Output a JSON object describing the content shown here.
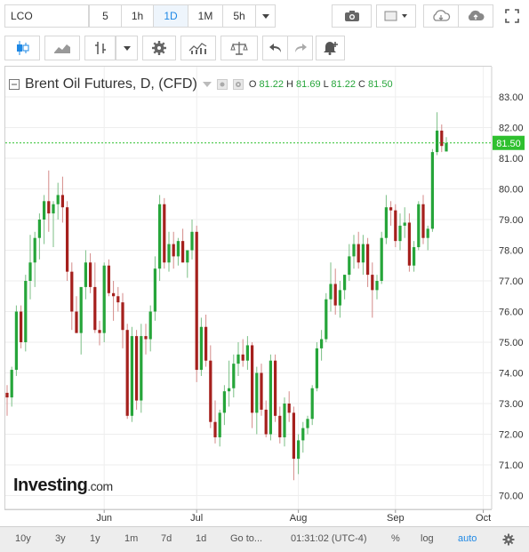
{
  "toolbar": {
    "symbol": "LCO",
    "intervals": [
      "5",
      "1h",
      "1D",
      "1M",
      "5h"
    ],
    "active_interval": "1D"
  },
  "legend": {
    "title": "Brent Oil Futures, D, (CFD)",
    "o_label": "O",
    "o": "81.22",
    "h_label": "H",
    "h": "81.69",
    "l_label": "L",
    "l": "81.22",
    "c_label": "C",
    "c": "81.50"
  },
  "price_badge": "81.50",
  "logo": {
    "main": "Investing",
    "suffix": ".com"
  },
  "bottom_bar": {
    "ranges": [
      "10y",
      "3y",
      "1y",
      "1m",
      "7d",
      "1d",
      "Go to..."
    ],
    "time": "01:31:02 (UTC-4)",
    "percent": "%",
    "log": "log",
    "auto": "auto"
  },
  "colors": {
    "up": "#26a53a",
    "down": "#a5201d",
    "grid": "#eeeeee",
    "active": "#1e88e5",
    "last_price": "#2fc02f"
  },
  "chart_data": {
    "type": "candlestick",
    "title": "Brent Oil Futures, D, (CFD)",
    "x_ticks": [
      "Jun",
      "Jul",
      "Aug",
      "Sep",
      "Oct"
    ],
    "y_ticks": [
      70.0,
      71.0,
      72.0,
      73.0,
      74.0,
      75.0,
      76.0,
      77.0,
      78.0,
      79.0,
      80.0,
      81.0,
      82.0,
      83.0
    ],
    "ylim": [
      69.5,
      83.5
    ],
    "last_price": 81.5,
    "grid": true,
    "candles": [
      [
        73.35,
        73.6,
        72.6,
        73.2
      ],
      [
        73.2,
        74.2,
        72.9,
        74.1
      ],
      [
        74.1,
        76.2,
        73.9,
        76.0
      ],
      [
        76.0,
        76.2,
        74.8,
        75.0
      ],
      [
        75.0,
        77.2,
        74.7,
        77.0
      ],
      [
        77.0,
        78.5,
        76.4,
        77.6
      ],
      [
        77.6,
        78.6,
        76.8,
        78.4
      ],
      [
        78.4,
        79.2,
        77.7,
        79.0
      ],
      [
        79.0,
        79.8,
        78.2,
        79.6
      ],
      [
        79.6,
        80.6,
        78.6,
        79.2
      ],
      [
        79.2,
        79.6,
        78.1,
        79.5
      ],
      [
        79.5,
        80.2,
        79.0,
        79.8
      ],
      [
        79.8,
        80.4,
        78.9,
        79.4
      ],
      [
        79.4,
        79.6,
        77.0,
        77.3
      ],
      [
        77.3,
        77.6,
        75.4,
        76.0
      ],
      [
        76.0,
        76.5,
        75.3,
        75.3
      ],
      [
        75.3,
        76.6,
        74.6,
        76.8
      ],
      [
        76.8,
        78.0,
        76.4,
        77.6
      ],
      [
        77.6,
        77.9,
        76.6,
        76.8
      ],
      [
        76.8,
        77.6,
        75.3,
        75.4
      ],
      [
        75.4,
        75.7,
        74.9,
        75.3
      ],
      [
        75.3,
        77.6,
        75.0,
        77.5
      ],
      [
        77.5,
        77.7,
        76.5,
        76.6
      ],
      [
        76.6,
        77.0,
        75.7,
        76.5
      ],
      [
        76.5,
        76.8,
        76.0,
        76.3
      ],
      [
        76.3,
        76.6,
        74.8,
        75.4
      ],
      [
        75.4,
        75.6,
        72.5,
        72.6
      ],
      [
        72.6,
        75.5,
        72.4,
        75.2
      ],
      [
        75.2,
        75.4,
        72.8,
        73.1
      ],
      [
        73.1,
        75.6,
        72.7,
        75.2
      ],
      [
        75.2,
        75.6,
        74.6,
        75.1
      ],
      [
        75.1,
        76.2,
        74.7,
        76.0
      ],
      [
        76.0,
        77.8,
        75.7,
        77.4
      ],
      [
        77.4,
        79.8,
        77.0,
        79.5
      ],
      [
        79.5,
        79.7,
        77.4,
        77.6
      ],
      [
        77.6,
        78.6,
        77.3,
        78.2
      ],
      [
        78.2,
        78.6,
        77.4,
        77.8
      ],
      [
        77.8,
        78.4,
        77.5,
        78.3
      ],
      [
        78.3,
        78.7,
        77.6,
        77.6
      ],
      [
        77.6,
        78.0,
        77.1,
        78.0
      ],
      [
        78.0,
        79.0,
        77.7,
        78.6
      ],
      [
        78.6,
        78.8,
        73.7,
        74.1
      ],
      [
        74.1,
        75.8,
        73.9,
        75.5
      ],
      [
        75.5,
        75.9,
        74.2,
        74.4
      ],
      [
        74.4,
        74.9,
        72.2,
        72.4
      ],
      [
        72.4,
        73.1,
        71.7,
        71.9
      ],
      [
        71.9,
        72.8,
        71.6,
        72.7
      ],
      [
        72.7,
        73.6,
        72.3,
        73.4
      ],
      [
        73.4,
        74.4,
        72.9,
        73.5
      ],
      [
        73.5,
        74.6,
        73.2,
        74.3
      ],
      [
        74.3,
        75.0,
        73.9,
        74.6
      ],
      [
        74.6,
        75.1,
        74.2,
        74.4
      ],
      [
        74.4,
        75.2,
        74.1,
        74.9
      ],
      [
        74.9,
        75.0,
        72.2,
        72.7
      ],
      [
        72.7,
        74.2,
        72.0,
        74.0
      ],
      [
        74.0,
        74.3,
        72.6,
        72.8
      ],
      [
        72.8,
        73.1,
        71.9,
        72.0
      ],
      [
        72.0,
        74.6,
        71.8,
        74.4
      ],
      [
        74.4,
        74.6,
        72.4,
        72.6
      ],
      [
        72.6,
        72.9,
        71.7,
        71.9
      ],
      [
        71.9,
        73.2,
        71.6,
        73.0
      ],
      [
        73.0,
        73.4,
        72.4,
        72.7
      ],
      [
        72.7,
        72.9,
        70.5,
        71.2
      ],
      [
        71.2,
        72.0,
        70.7,
        71.8
      ],
      [
        71.8,
        72.4,
        71.4,
        72.2
      ],
      [
        72.2,
        72.6,
        72.0,
        72.5
      ],
      [
        72.5,
        73.6,
        72.3,
        73.5
      ],
      [
        73.5,
        75.0,
        73.4,
        74.8
      ],
      [
        74.8,
        75.4,
        74.4,
        75.1
      ],
      [
        75.1,
        76.6,
        75.0,
        76.4
      ],
      [
        76.4,
        77.6,
        76.0,
        76.9
      ],
      [
        76.9,
        77.4,
        75.9,
        76.2
      ],
      [
        76.2,
        77.0,
        75.8,
        76.7
      ],
      [
        76.7,
        77.2,
        76.4,
        77.2
      ],
      [
        77.2,
        78.2,
        77.0,
        77.8
      ],
      [
        77.8,
        78.5,
        77.4,
        78.2
      ],
      [
        78.2,
        78.6,
        77.4,
        77.6
      ],
      [
        77.6,
        78.5,
        77.2,
        78.2
      ],
      [
        78.2,
        78.4,
        76.8,
        77.2
      ],
      [
        77.2,
        77.6,
        75.8,
        76.7
      ],
      [
        76.7,
        77.2,
        76.4,
        77.0
      ],
      [
        77.0,
        78.6,
        76.9,
        78.4
      ],
      [
        78.4,
        79.8,
        78.2,
        79.4
      ],
      [
        79.4,
        79.6,
        78.8,
        79.3
      ],
      [
        79.3,
        79.5,
        78.1,
        78.3
      ],
      [
        78.3,
        79.2,
        78.0,
        78.8
      ],
      [
        78.8,
        79.4,
        78.4,
        78.9
      ],
      [
        78.9,
        79.2,
        77.3,
        77.5
      ],
      [
        77.5,
        78.3,
        77.3,
        78.1
      ],
      [
        78.1,
        79.6,
        78.0,
        79.5
      ],
      [
        79.5,
        79.8,
        78.2,
        78.4
      ],
      [
        78.4,
        78.8,
        78.0,
        78.7
      ],
      [
        78.7,
        81.3,
        78.6,
        81.2
      ],
      [
        81.2,
        82.5,
        81.1,
        81.9
      ],
      [
        81.9,
        82.1,
        81.2,
        81.4
      ],
      [
        81.22,
        81.69,
        81.22,
        81.5
      ]
    ]
  }
}
